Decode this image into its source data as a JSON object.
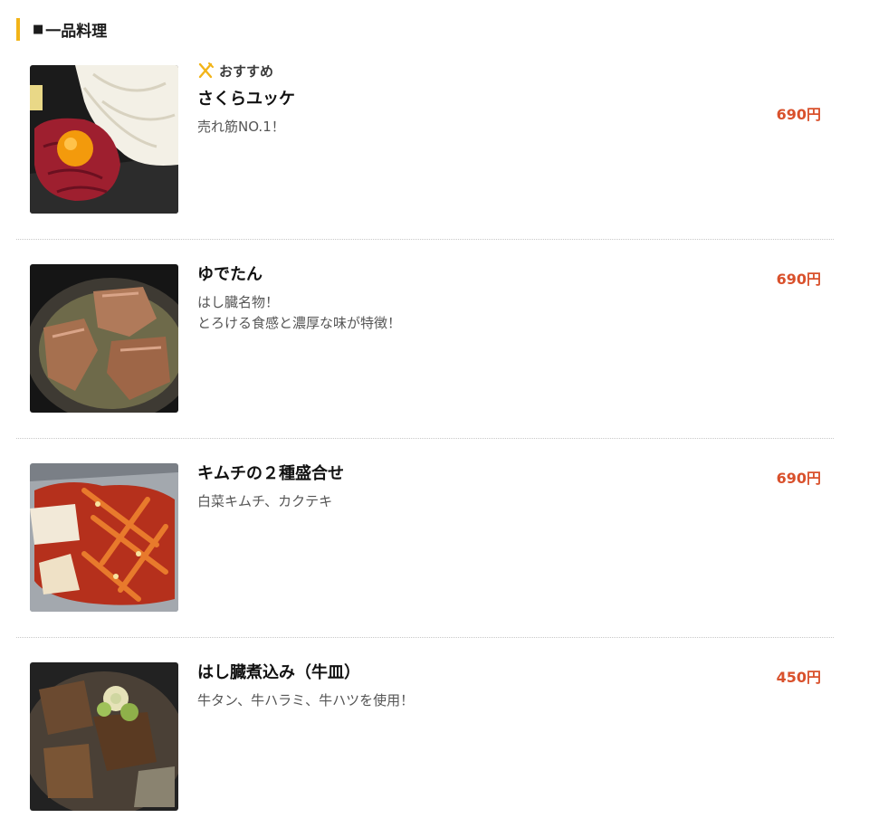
{
  "section": {
    "marker": "■",
    "title": "一品料理",
    "accent_color": "#f2b418"
  },
  "recommend": {
    "label": "おすすめ",
    "icon": "fork-knife-icon"
  },
  "price_color": "#d9512c",
  "items": [
    {
      "name": "さくらユッケ",
      "desc": [
        "売れ筋NO.1！"
      ],
      "price": "690円",
      "recommended": true,
      "image": "sakura-yukke-photo"
    },
    {
      "name": "ゆでたん",
      "desc": [
        "はし臓名物！",
        "とろける食感と濃厚な味が特徴！"
      ],
      "price": "690円",
      "recommended": false,
      "image": "boiled-tongue-photo"
    },
    {
      "name": "キムチの２種盛合せ",
      "desc": [
        "白菜キムチ、カクテキ"
      ],
      "price": "690円",
      "recommended": false,
      "image": "kimchi-platter-photo"
    },
    {
      "name": "はし臓煮込み（牛皿）",
      "desc": [
        "牛タン、牛ハラミ、牛ハツを使用！"
      ],
      "price": "450円",
      "recommended": false,
      "image": "beef-stew-photo"
    }
  ]
}
